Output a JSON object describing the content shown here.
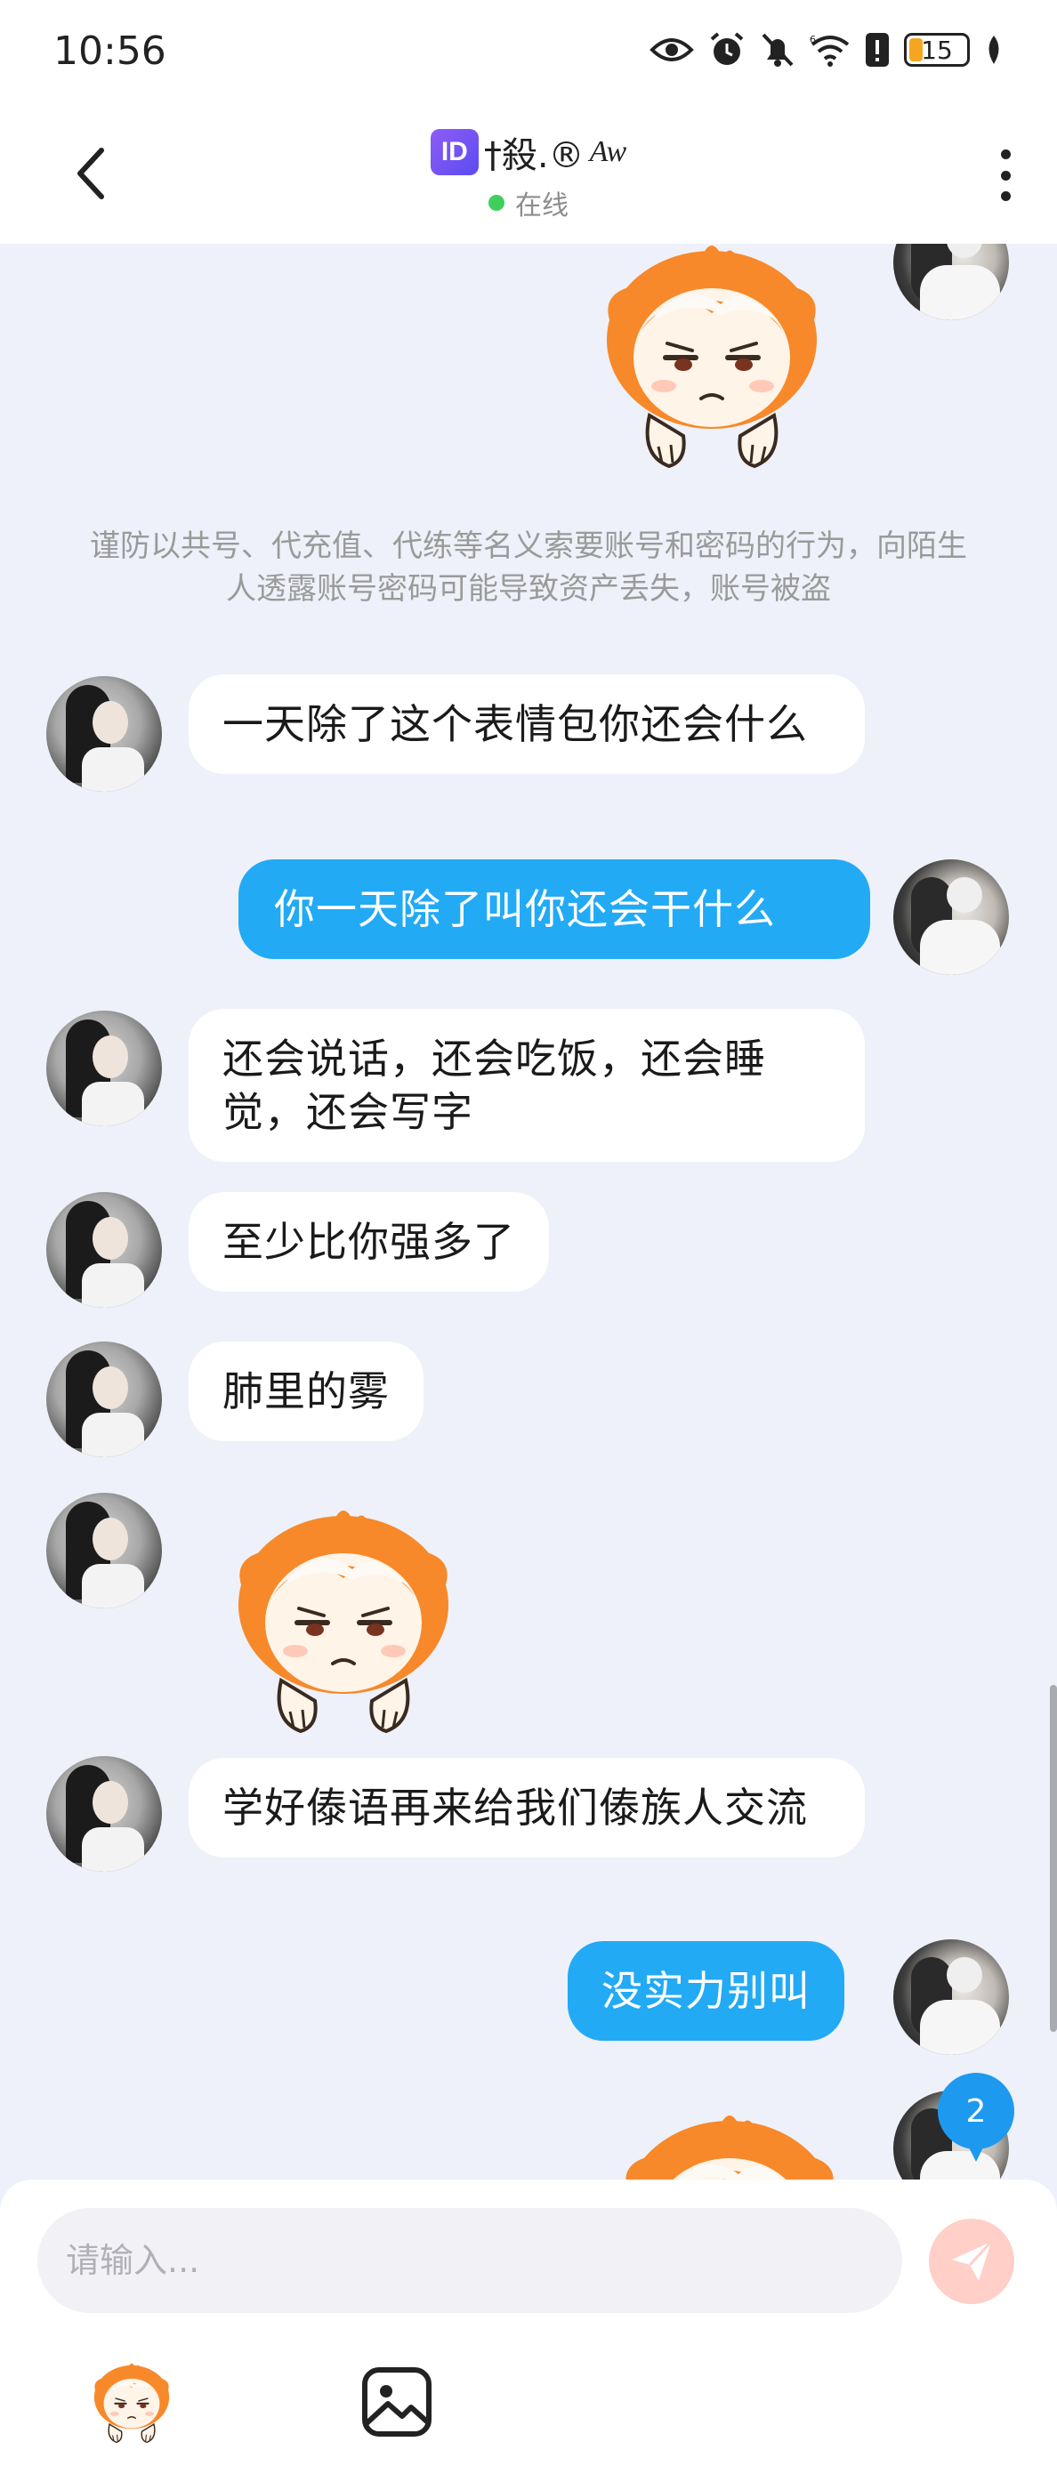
{
  "status_bar": {
    "time": "10:56",
    "battery_level": "15",
    "icons": [
      "eye-icon",
      "alarm-icon",
      "bell-muted-icon",
      "wifi-icon",
      "sim-alert-icon",
      "battery-icon",
      "leaf-icon"
    ]
  },
  "header": {
    "id_badge": "ID",
    "title": "†殺.®",
    "title_suffix": "Aw",
    "status_text": "在线"
  },
  "chat": {
    "notice": "谨防以共号、代充值、代练等名义索要账号和密码的行为，向陌生人透露账号密码可能导致资产丢失，账号被盗",
    "messages": [
      {
        "side": "right",
        "type": "sticker",
        "sticker": "annoyed-mascot-sticker"
      },
      {
        "side": "left",
        "type": "text",
        "text": "一天除了这个表情包你还会什么"
      },
      {
        "side": "right",
        "type": "text",
        "text": "你一天除了叫你还会干什么"
      },
      {
        "side": "left",
        "type": "text",
        "text": "还会说话，还会吃饭，还会睡觉，还会写字"
      },
      {
        "side": "left",
        "type": "text",
        "text": "至少比你强多了"
      },
      {
        "side": "left",
        "type": "text",
        "text": "肺里的雾"
      },
      {
        "side": "left",
        "type": "sticker",
        "sticker": "annoyed-mascot-sticker"
      },
      {
        "side": "left",
        "type": "text",
        "text": "学好傣语再来给我们傣族人交流"
      },
      {
        "side": "right",
        "type": "text",
        "text": "没实力别叫"
      },
      {
        "side": "right",
        "type": "sticker",
        "sticker": "annoyed-mascot-sticker"
      }
    ],
    "unread_count": "2"
  },
  "composer": {
    "placeholder": "请输入...",
    "tools": [
      "emoji-mascot-icon",
      "image-icon"
    ],
    "send_icon": "send-icon"
  },
  "colors": {
    "accent_blue": "#22aaf5",
    "background": "#eef1f9",
    "sticker_orange": "#f7892a"
  }
}
